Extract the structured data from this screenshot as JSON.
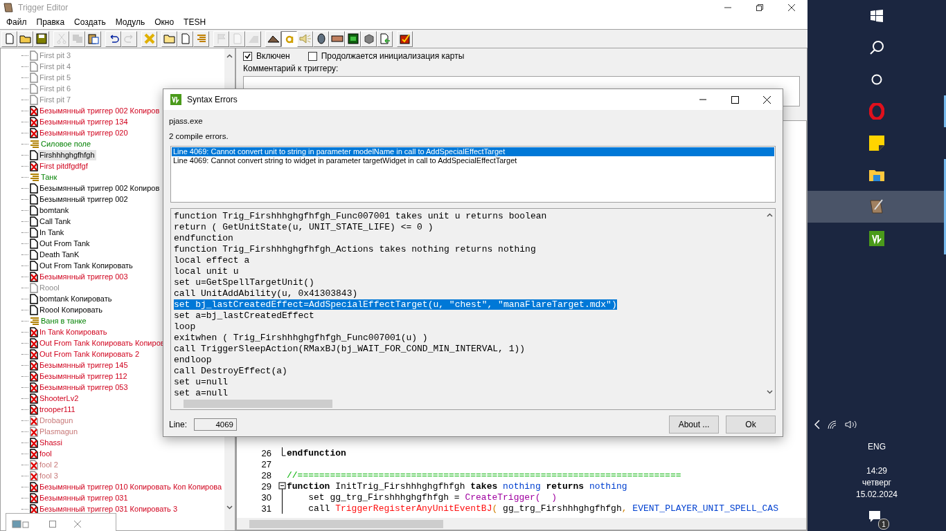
{
  "window": {
    "title": "Trigger Editor"
  },
  "menu": [
    "Файл",
    "Правка",
    "Создать",
    "Модуль",
    "Окно",
    "TESH"
  ],
  "toolbar": [
    [
      {
        "kind": "new",
        "disabled": false,
        "pressed": false
      },
      {
        "kind": "open",
        "disabled": false,
        "pressed": false
      },
      {
        "kind": "save",
        "disabled": false,
        "pressed": false
      }
    ],
    [
      {
        "kind": "cut",
        "disabled": true,
        "pressed": false
      },
      {
        "kind": "copy",
        "disabled": true,
        "pressed": false
      },
      {
        "kind": "paste",
        "disabled": false,
        "pressed": false
      }
    ],
    [
      {
        "kind": "undo",
        "disabled": false,
        "pressed": false
      },
      {
        "kind": "redo",
        "disabled": true,
        "pressed": false
      }
    ],
    [
      {
        "kind": "delete",
        "disabled": false,
        "pressed": false
      }
    ],
    [
      {
        "kind": "category",
        "disabled": false,
        "pressed": false
      },
      {
        "kind": "trigger",
        "disabled": false,
        "pressed": false
      },
      {
        "kind": "comment",
        "disabled": false,
        "pressed": false
      }
    ],
    [
      {
        "kind": "event",
        "disabled": true,
        "pressed": false
      },
      {
        "kind": "condition",
        "disabled": true,
        "pressed": false
      },
      {
        "kind": "action",
        "disabled": true,
        "pressed": false
      }
    ],
    [
      {
        "kind": "terrain",
        "disabled": false,
        "pressed": false
      },
      {
        "kind": "text",
        "disabled": false,
        "pressed": true
      },
      {
        "kind": "sound",
        "disabled": false,
        "pressed": false
      },
      {
        "kind": "unit",
        "disabled": false,
        "pressed": false
      },
      {
        "kind": "object",
        "disabled": false,
        "pressed": false
      },
      {
        "kind": "monster",
        "disabled": false,
        "pressed": false
      },
      {
        "kind": "cube",
        "disabled": false,
        "pressed": false
      },
      {
        "kind": "import",
        "disabled": false,
        "pressed": false
      }
    ],
    [
      {
        "kind": "test",
        "disabled": false,
        "pressed": false
      }
    ]
  ],
  "tree": [
    {
      "label": "First pit 3",
      "kind": "trigger",
      "disabled": true,
      "selected": false
    },
    {
      "label": "First pit 4",
      "kind": "trigger",
      "disabled": true,
      "selected": false
    },
    {
      "label": "First pit 5",
      "kind": "trigger",
      "disabled": true,
      "selected": false
    },
    {
      "label": "First pit  6",
      "kind": "trigger",
      "disabled": true,
      "selected": false
    },
    {
      "label": "First pit 7",
      "kind": "trigger",
      "disabled": true,
      "selected": false
    },
    {
      "label": "Безымянный триггер 002 Копиров",
      "kind": "error",
      "disabled": false,
      "selected": false
    },
    {
      "label": "Безымянный триггер 134",
      "kind": "error",
      "disabled": false,
      "selected": false
    },
    {
      "label": "Безымянный триггер 020",
      "kind": "error",
      "disabled": false,
      "selected": false
    },
    {
      "label": "Силовое поле",
      "kind": "comment",
      "disabled": false,
      "selected": false
    },
    {
      "label": "Firshhhghgfhfgh",
      "kind": "trigger",
      "disabled": false,
      "selected": true
    },
    {
      "label": "First pitdfgdfgf",
      "kind": "error",
      "disabled": false,
      "selected": false
    },
    {
      "label": "Танк",
      "kind": "comment",
      "disabled": false,
      "selected": false
    },
    {
      "label": "Безымянный триггер 002 Копиров",
      "kind": "trigger",
      "disabled": false,
      "selected": false
    },
    {
      "label": "Безымянный триггер 002",
      "kind": "trigger",
      "disabled": false,
      "selected": false
    },
    {
      "label": "bomtank",
      "kind": "trigger",
      "disabled": false,
      "selected": false
    },
    {
      "label": "Call Tank",
      "kind": "trigger",
      "disabled": false,
      "selected": false
    },
    {
      "label": "In Tank",
      "kind": "trigger",
      "disabled": false,
      "selected": false
    },
    {
      "label": "Out From Tank",
      "kind": "trigger",
      "disabled": false,
      "selected": false
    },
    {
      "label": "Death TanK",
      "kind": "trigger",
      "disabled": false,
      "selected": false
    },
    {
      "label": "Out From Tank Копировать",
      "kind": "trigger",
      "disabled": false,
      "selected": false
    },
    {
      "label": "Безымянный триггер 003",
      "kind": "error",
      "disabled": false,
      "selected": false
    },
    {
      "label": "Roool",
      "kind": "trigger",
      "disabled": true,
      "selected": false
    },
    {
      "label": "bomtank Копировать",
      "kind": "trigger",
      "disabled": false,
      "selected": false
    },
    {
      "label": "Roool Копировать",
      "kind": "trigger",
      "disabled": false,
      "selected": false
    },
    {
      "label": "Ваня в танке",
      "kind": "comment",
      "disabled": false,
      "selected": false
    },
    {
      "label": "In Tank Копировать",
      "kind": "error",
      "disabled": false,
      "selected": false
    },
    {
      "label": "Out From Tank Копировать Копиров",
      "kind": "error",
      "disabled": false,
      "selected": false
    },
    {
      "label": "Out From Tank Копировать 2",
      "kind": "error",
      "disabled": false,
      "selected": false
    },
    {
      "label": "Безымянный триггер 145",
      "kind": "error",
      "disabled": false,
      "selected": false
    },
    {
      "label": "Безымянный триггер 112",
      "kind": "error",
      "disabled": false,
      "selected": false
    },
    {
      "label": "Безымянный триггер 053",
      "kind": "error",
      "disabled": false,
      "selected": false
    },
    {
      "label": "ShooterLv2",
      "kind": "error",
      "disabled": false,
      "selected": false
    },
    {
      "label": "trooper111",
      "kind": "error",
      "disabled": false,
      "selected": false
    },
    {
      "label": "Drobagun",
      "kind": "error",
      "disabled": true,
      "selected": false
    },
    {
      "label": "Plasmagun",
      "kind": "error",
      "disabled": true,
      "selected": false
    },
    {
      "label": "Shassi",
      "kind": "error",
      "disabled": false,
      "selected": false
    },
    {
      "label": "fool",
      "kind": "error",
      "disabled": false,
      "selected": false
    },
    {
      "label": "fool 2",
      "kind": "error",
      "disabled": true,
      "selected": false
    },
    {
      "label": "fool 3",
      "kind": "error",
      "disabled": true,
      "selected": false
    },
    {
      "label": "Безымянный триггер 010 Копировать Коп Копирова",
      "kind": "error",
      "disabled": false,
      "selected": false
    },
    {
      "label": "Безымянный триггер 031",
      "kind": "error",
      "disabled": false,
      "selected": false
    },
    {
      "label": "Безымянный триггер 031 Копировать 3",
      "kind": "error",
      "disabled": false,
      "selected": false
    }
  ],
  "trigger_panel": {
    "enabled": {
      "label": "Включен",
      "checked": true
    },
    "initially_on": {
      "label": "Продолжается инициализация карты",
      "checked": false
    },
    "comment_label": "Комментарий к триггеру:"
  },
  "editor": {
    "lines": [
      {
        "number": "26",
        "kind": "block_end",
        "tokens": [
          {
            "text": "endfunction",
            "kind": "keyword"
          }
        ]
      },
      {
        "number": "27",
        "kind": "plain"
      },
      {
        "number": "28",
        "kind": "plain",
        "tokens": [
          {
            "text": "//=======================================================================",
            "kind": "comment"
          }
        ]
      },
      {
        "number": "29",
        "kind": "block_start",
        "tokens": [
          {
            "text": "function",
            "kind": "keyword"
          },
          {
            "text": " InitTrig_Firshhhghgfhfgh ",
            "kind": "plain"
          },
          {
            "text": "takes",
            "kind": "keyword"
          },
          {
            "text": " nothing",
            "kind": "type"
          },
          {
            "text": " returns",
            "kind": "keyword"
          },
          {
            "text": " nothing",
            "kind": "type"
          }
        ]
      },
      {
        "number": "30",
        "kind": "block_body",
        "tokens": [
          {
            "text": "    set gg_trg_Firshhhghgfhfgh = ",
            "kind": "plain"
          },
          {
            "text": "CreateTrigger(  )",
            "kind": "native"
          }
        ]
      },
      {
        "number": "31",
        "kind": "block_body",
        "tokens": [
          {
            "text": "    call ",
            "kind": "plain"
          },
          {
            "text": "TriggerRegisterAnyUnitEventBJ",
            "kind": "function"
          },
          {
            "text": "(",
            "kind": "paren"
          },
          {
            "text": " gg_trg_Firshhhghgfhfgh",
            "kind": "plain"
          },
          {
            "text": ", ",
            "kind": "paren"
          },
          {
            "text": "EVENT_PLAYER_UNIT_SPELL_CAS",
            "kind": "type"
          }
        ]
      }
    ]
  },
  "dialog": {
    "title": "Syntax Errors",
    "tool": "pjass.exe",
    "summary": "2 compile errors.",
    "errors": [
      {
        "text": "Line 4069:  Cannot convert unit to string in parameter modelName in call to AddSpecialEffectTarget",
        "selected": true
      },
      {
        "text": "Line 4069:  Cannot convert string to widget in parameter targetWidget in call to AddSpecialEffectTarget",
        "selected": false
      }
    ],
    "code": [
      {
        "text": "function Trig_Firshhhghgfhfgh_Func007001 takes unit u returns boolean",
        "selected": false
      },
      {
        "text": "return ( GetUnitState(u, UNIT_STATE_LIFE) <= 0 )",
        "selected": false
      },
      {
        "text": "endfunction",
        "selected": false
      },
      {
        "text": "function Trig_Firshhhghgfhfgh_Actions takes nothing returns nothing",
        "selected": false
      },
      {
        "text": "local effect a",
        "selected": false
      },
      {
        "text": "local unit u",
        "selected": false
      },
      {
        "text": "set u=GetSpellTargetUnit()",
        "selected": false
      },
      {
        "text": "call UnitAddAbility(u, 0x41303843)",
        "selected": false
      },
      {
        "text": "set bj_lastCreatedEffect=AddSpecialEffectTarget(u, \"chest\", \"manaFlareTarget.mdx\")",
        "selected": true
      },
      {
        "text": "set a=bj_lastCreatedEffect",
        "selected": false
      },
      {
        "text": "loop",
        "selected": false
      },
      {
        "text": "exitwhen ( Trig_Firshhhghgfhfgh_Func007001(u) )",
        "selected": false
      },
      {
        "text": "call TriggerSleepAction(RMaxBJ(bj_WAIT_FOR_COND_MIN_INTERVAL, 1))",
        "selected": false
      },
      {
        "text": "endloop",
        "selected": false
      },
      {
        "text": "call DestroyEffect(a)",
        "selected": false
      },
      {
        "text": "set u=null",
        "selected": false
      },
      {
        "text": "set a=null",
        "selected": false
      }
    ],
    "line_label": "Line:",
    "line_value": "4069",
    "buttons": [
      "About ...",
      "Ok"
    ]
  },
  "taskbar": {
    "apps": [
      {
        "kind": "opera",
        "running": true,
        "selected": false
      },
      {
        "kind": "notes",
        "running": false,
        "selected": false
      },
      {
        "kind": "explorer",
        "running": true,
        "selected": false
      },
      {
        "kind": "editor",
        "running": true,
        "selected": true
      },
      {
        "kind": "green",
        "running": true,
        "selected": false
      }
    ],
    "language": "ENG",
    "time": "14:29",
    "weekday": "четверг",
    "date": "15.02.2024",
    "notifications": "1"
  }
}
